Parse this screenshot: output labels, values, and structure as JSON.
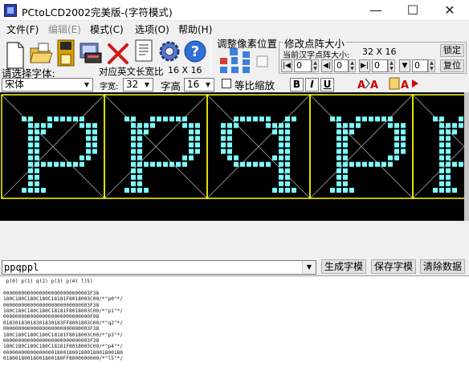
{
  "window": {
    "title": "PCtoLCD2002完美版-(字符模式)",
    "minimize": "—",
    "maximize": "☐",
    "close": "✕"
  },
  "menu": [
    {
      "label": "文件(F)",
      "enabled": true
    },
    {
      "label": "编辑(E)",
      "enabled": false
    },
    {
      "label": "模式(C)",
      "enabled": true
    },
    {
      "label": "选项(O)",
      "enabled": true
    },
    {
      "label": "帮助(H)",
      "enabled": true
    }
  ],
  "toolbar": {
    "icons": [
      "new-file-icon",
      "open-folder-icon",
      "save-icon",
      "generate-code-icon",
      "delete-icon",
      "notes-icon",
      "settings-gear-icon",
      "help-icon"
    ]
  },
  "adjust_pixel": {
    "title": "调整像素位置"
  },
  "matrix_size": {
    "title": "修改点阵大小",
    "current_label": "当前汉字点阵大小:",
    "current_value": "32 X 16",
    "lock_button": "锁定",
    "restore_button": "复位",
    "spin_values": [
      "0",
      "0",
      "0",
      "0"
    ]
  },
  "font_row1": {
    "choose_font_label": "请选择字体:",
    "english_width_label": "对应英文长宽比",
    "english_width_value": "16 X 16"
  },
  "font_row2": {
    "font_name": "宋体",
    "width_label": "字宽:",
    "width_value": "32",
    "height_label": "字高",
    "height_value": "16",
    "proportional_label": "等比缩放",
    "bold": "B",
    "italic": "I",
    "underline": "U"
  },
  "lcd": {
    "characters": [
      "p",
      "p",
      "q",
      "p",
      "p"
    ],
    "colors": {
      "background": "#000000",
      "pixel": "#7fffff",
      "grid": "#ffff00",
      "diagonal": "#aaaaaa"
    }
  },
  "bottom": {
    "input_text": "ppqppl",
    "generate_button": "生成字模",
    "save_button": "保存字模",
    "clear_button": "清除数据"
  },
  "output_lines": [
    " p(0) p(1) q(2) p(3) p(4) l(5)",
    "",
    "00000000000000000000000000003F38",
    "180C180C180C180C18181F8018003C00/*\"p0\"*/",
    "00000000000000000000000000003F38",
    "180C180C180C180C18181F8018003C00/*\"p1\"*/",
    "00000000000000000000000000000F98",
    "01830183018301830183FF8001803C00/*\"q2\"*/",
    "00000000000000000000000000003F38",
    "180C180C180C180C18181F8018003C00/*\"p3\"*/",
    "00000000000000000000000000003F38",
    "180C180C180C180C18181F8018003C00/*\"p4\"*/",
    "0000000000000000018001800180018001800180",
    "01800180018001800180FF8000000000/*\"l5\"*/"
  ]
}
